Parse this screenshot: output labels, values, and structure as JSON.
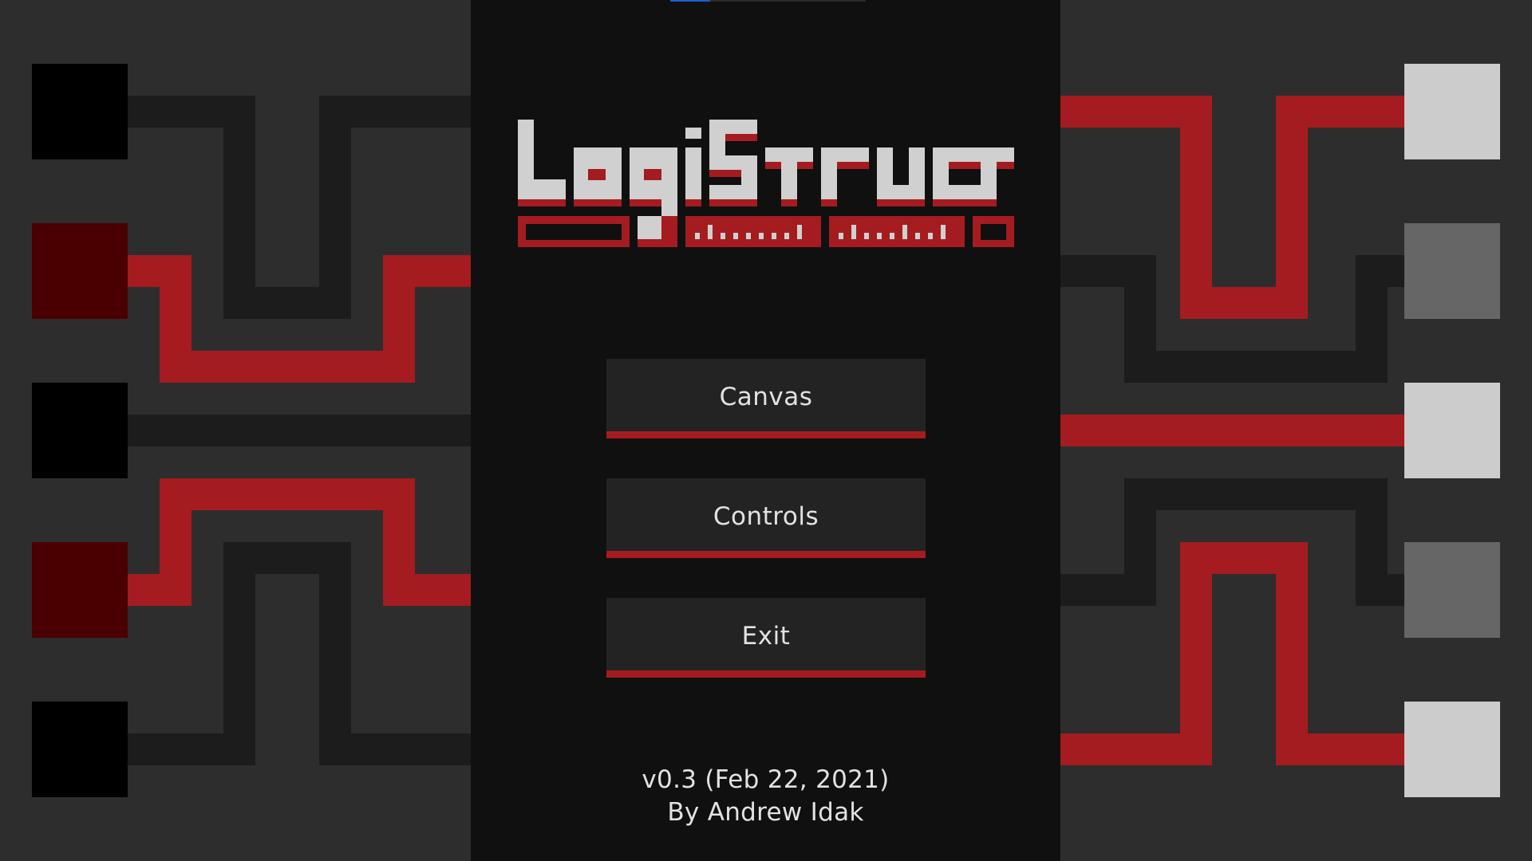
{
  "app": {
    "title": "LogiStruct",
    "version": "v0.3 (Feb 22, 2021)",
    "author": "By Andrew Idak"
  },
  "menu": {
    "buttons": [
      {
        "label": "Canvas"
      },
      {
        "label": "Controls"
      },
      {
        "label": "Exit"
      }
    ]
  },
  "decor": {
    "left_nodes": [
      "off",
      "on",
      "off",
      "on",
      "off"
    ],
    "right_nodes": [
      "on",
      "off",
      "on",
      "off",
      "on"
    ]
  },
  "colors": {
    "background": "#2d2d2d",
    "center_panel": "#101010",
    "button_bg": "#232323",
    "accent_red": "#a41c1f",
    "wire_off": "#1c1c1c",
    "text": "#e2e2e2",
    "node_black": "#000000",
    "node_dark_red": "#4a0000",
    "node_light": "#cccccc",
    "node_gray": "#666666"
  }
}
